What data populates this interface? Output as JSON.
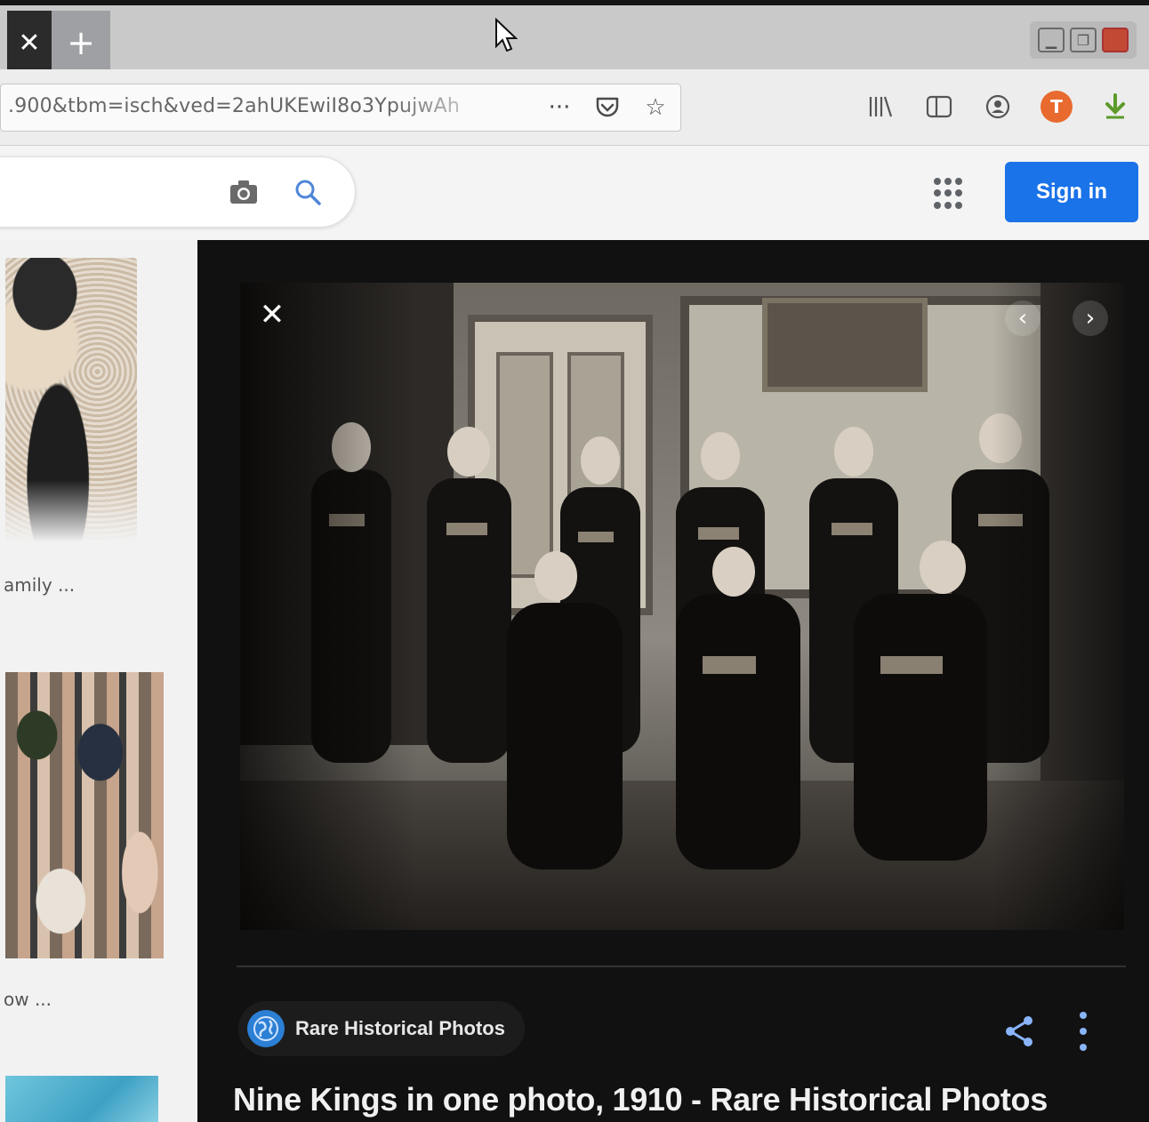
{
  "browser": {
    "tab_close_glyph": "✕",
    "new_tab_glyph": "+",
    "url_text": ".900&tbm=isch&ved=2ahUKEwiI8o3YpujwAh",
    "url_actions": [
      "more-icon",
      "pocket-icon",
      "star-icon"
    ],
    "toolbar_icons": [
      "library-icon",
      "sidebar-icon",
      "account-icon",
      "extension-t-icon",
      "download-icon"
    ],
    "extension_letter": "T"
  },
  "google": {
    "signin_label": "Sign in",
    "accent": "#1a73e8"
  },
  "results": {
    "caption_1": "amily ...",
    "caption_2": "ow ..."
  },
  "preview": {
    "close_glyph": "✕",
    "prev_glyph": "‹",
    "next_glyph": "›",
    "source_name": "Rare Historical Photos",
    "title": "Nine Kings in one photo, 1910 - Rare Historical Photos",
    "link_color": "#8ab4f8"
  }
}
